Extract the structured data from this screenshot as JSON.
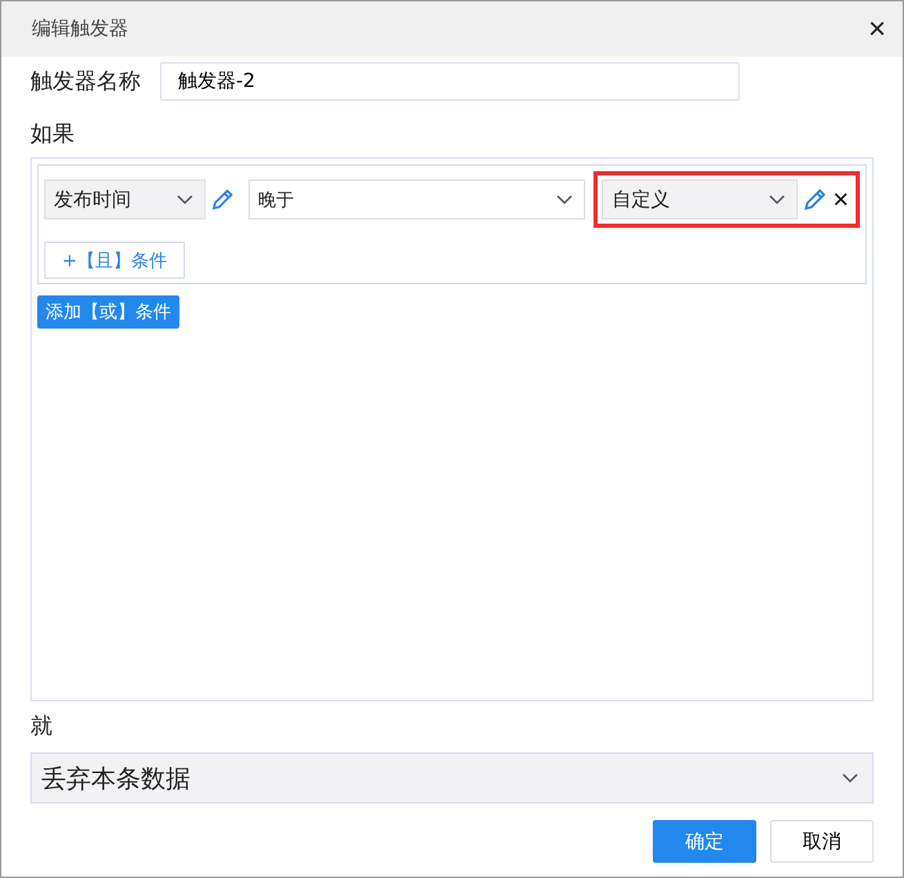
{
  "window": {
    "title": "编辑触发器",
    "close": "×"
  },
  "name_field": {
    "label": "触发器名称",
    "value": "触发器-2"
  },
  "if_section": {
    "label": "如果",
    "conditions": [
      {
        "field": "发布时间",
        "operator": "晚于",
        "value": "自定义",
        "value_highlighted": true,
        "remove": "×"
      }
    ],
    "add_and": "+【且】条件",
    "add_or": "添加【或】条件"
  },
  "then_section": {
    "label": "就",
    "action": "丢弃本条数据"
  },
  "buttons": [
    {
      "label": "确定",
      "kind": "primary"
    },
    {
      "label": "取消",
      "kind": "default"
    }
  ]
}
